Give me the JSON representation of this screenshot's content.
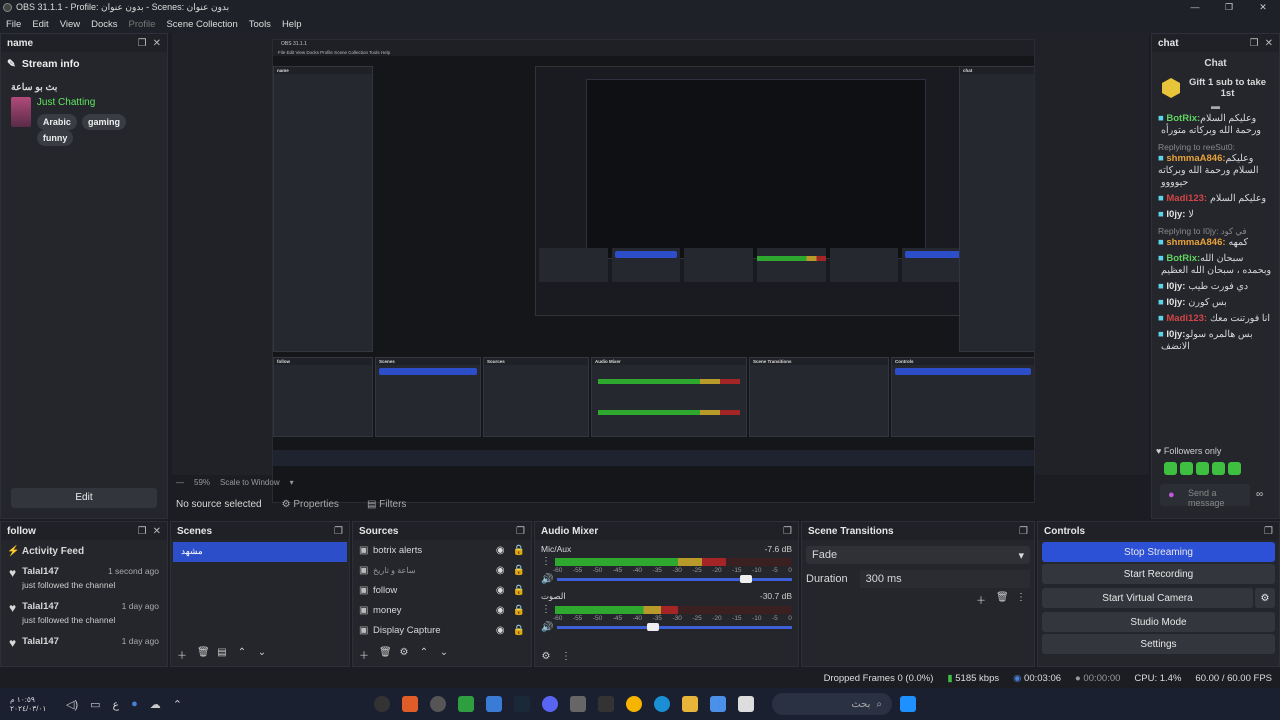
{
  "window": {
    "title": "OBS 31.1.1 - Profile: بدون عنوان - Scenes: بدون عنوان",
    "minimize": "—",
    "maximize": "❐",
    "close": "✕"
  },
  "menu": [
    "File",
    "Edit",
    "View",
    "Docks",
    "Profile",
    "Scene Collection",
    "Tools",
    "Help"
  ],
  "name_dock": {
    "title": "name",
    "stream_info": "Stream info",
    "stream_title": "بث بو ساعة",
    "category": "Just Chatting",
    "tags": [
      "Arabic",
      "gaming",
      "funny"
    ],
    "edit": "Edit"
  },
  "chat_dock": {
    "title": "chat",
    "header": "Chat",
    "gift": "Gift 1 sub to take 1st",
    "followers_only": "Followers only",
    "send_placeholder": "Send a message",
    "lines": [
      {
        "nick": "BotRix:",
        "color": "#5fd35f",
        "text": "وعليكم السلام ورحمة الله وبركاته متورأه"
      },
      {
        "reply": "Replying to reeSut0:",
        "nick": "shmmaA846:",
        "color": "#e8a23a",
        "text": "وعليكم السلام ورحمة الله وبركاته حيوووو"
      },
      {
        "nick": "Madi123:",
        "color": "#d44545",
        "text": "وعليكم السلام"
      },
      {
        "nick": "I0jy:",
        "color": "#e3e3e3",
        "text": "لا"
      },
      {
        "reply": "Replying to I0jy: في كود",
        "nick": "shmmaA846:",
        "color": "#e8a23a",
        "text": "كمهه"
      },
      {
        "nick": "BotRix:",
        "color": "#5fd35f",
        "text": "سبحان الله وبحمده ، سبحان الله العظيم"
      },
      {
        "nick": "I0jy:",
        "color": "#e3e3e3",
        "text": "دي فورت طيب"
      },
      {
        "nick": "I0jy:",
        "color": "#e3e3e3",
        "text": "بس كورن"
      },
      {
        "nick": "Madi123:",
        "color": "#d44545",
        "text": "انا فورتنت معك"
      },
      {
        "nick": "I0jy:",
        "color": "#e3e3e3",
        "text": "بس هالمره سولو الانضف"
      }
    ]
  },
  "preview": {
    "scale_percent": "59%",
    "scale_mode": "Scale to Window"
  },
  "source_bar": {
    "no_source": "No source selected",
    "properties": "Properties",
    "filters": "Filters"
  },
  "follow_dock": {
    "title": "follow",
    "feed_title": "Activity Feed",
    "items": [
      {
        "user": "Talal147",
        "time": "1 second ago",
        "text": "just followed the channel"
      },
      {
        "user": "Talal147",
        "time": "1 day ago",
        "text": "just followed the channel"
      },
      {
        "user": "Talal147",
        "time": "1 day ago",
        "text": ""
      }
    ]
  },
  "scenes": {
    "title": "Scenes",
    "items": [
      "مشهد"
    ]
  },
  "sources": {
    "title": "Sources",
    "items": [
      "botrix alerts",
      "ساعة و تاريخ",
      "follow",
      "money",
      "Display Capture"
    ]
  },
  "mixer": {
    "title": "Audio Mixer",
    "channels": [
      {
        "name": "Mic/Aux",
        "db": "-7.6 dB",
        "level": 0.72,
        "volume": 0.78
      },
      {
        "name": "الصوت",
        "db": "-30.7 dB",
        "level": 0.52,
        "volume": 0.38
      }
    ],
    "scale": [
      "-60",
      "-55",
      "-50",
      "-45",
      "-40",
      "-35",
      "-30",
      "-25",
      "-20",
      "-15",
      "-10",
      "-5",
      "0"
    ]
  },
  "transitions": {
    "title": "Scene Transitions",
    "selected": "Fade",
    "duration_label": "Duration",
    "duration": "300 ms"
  },
  "controls": {
    "title": "Controls",
    "buttons": [
      "Stop Streaming",
      "Start Recording",
      "Start Virtual Camera",
      "Studio Mode",
      "Settings"
    ]
  },
  "status": {
    "dropped": "Dropped Frames 0 (0.0%)",
    "kbps": "5185 kbps",
    "stream_time": "00:03:06",
    "rec_time": "00:00:00",
    "cpu": "CPU: 1.4%",
    "fps": "60.00 / 60.00 FPS"
  },
  "taskbar": {
    "time": "١٠:٥٩ م",
    "date": "٢٠٢٤/٠٣/٠١",
    "search": "بحث"
  },
  "colors": {
    "accent": "#2c50d6",
    "panel": "#24262c",
    "bg": "#1b1d22"
  }
}
